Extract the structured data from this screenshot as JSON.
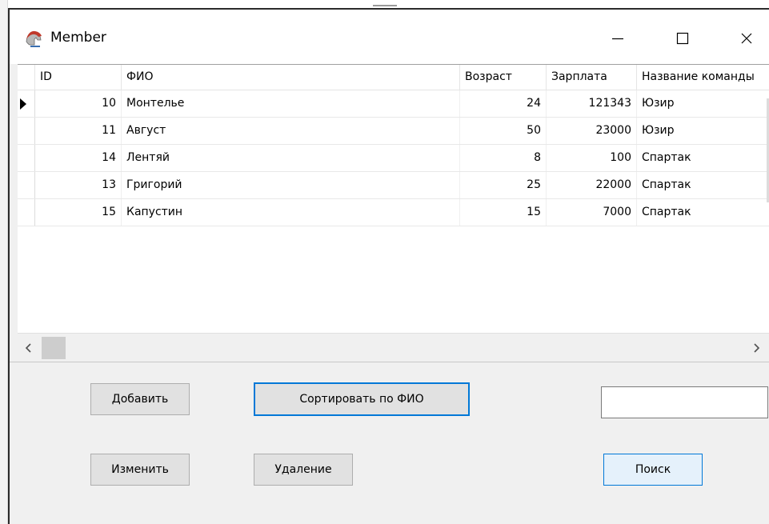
{
  "window": {
    "title": "Member",
    "icon": "spartan-helmet-icon",
    "controls": [
      "minimize-icon",
      "maximize-icon",
      "close-icon"
    ]
  },
  "grid": {
    "columns": [
      "ID",
      "ФИО",
      "Возраст",
      "Зарплата",
      "Название команды"
    ],
    "rows": [
      {
        "id": "10",
        "fio": "Монтелье",
        "age": "24",
        "salary": "121343",
        "team": "Юзир",
        "selected": true
      },
      {
        "id": "11",
        "fio": "Август",
        "age": "50",
        "salary": "23000",
        "team": "Юзир"
      },
      {
        "id": "14",
        "fio": "Лентяй",
        "age": "8",
        "salary": "100",
        "team": "Спартак"
      },
      {
        "id": "13",
        "fio": "Григорий",
        "age": "25",
        "salary": "22000",
        "team": "Спартак"
      },
      {
        "id": "15",
        "fio": "Капустин",
        "age": "15",
        "salary": "7000",
        "team": "Спартак"
      }
    ]
  },
  "buttons": {
    "add": "Добавить",
    "sort": "Сортировать по ФИО",
    "edit": "Изменить",
    "delete": "Удаление",
    "search": "Поиск"
  },
  "search": {
    "value": "",
    "placeholder": ""
  },
  "colors": {
    "accent": "#0078d7",
    "button_face": "#e1e1e1",
    "window_bg": "#f0f0f0"
  }
}
